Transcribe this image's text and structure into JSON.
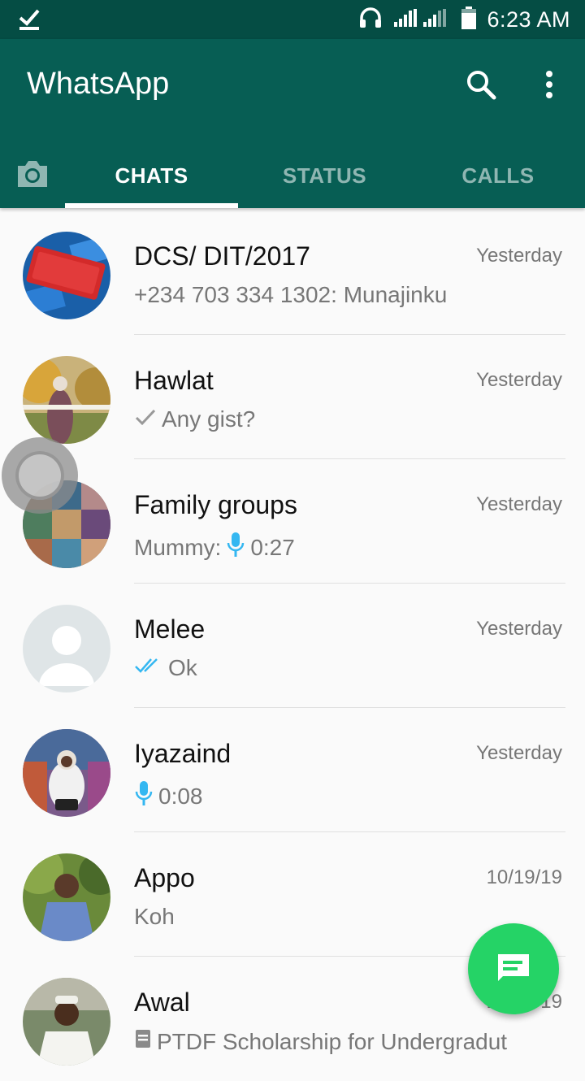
{
  "status_bar": {
    "time": "6:23 AM"
  },
  "app_bar": {
    "title": "WhatsApp"
  },
  "tabs": [
    {
      "label": "CHATS",
      "active": true
    },
    {
      "label": "STATUS",
      "active": false
    },
    {
      "label": "CALLS",
      "active": false
    }
  ],
  "chats": [
    {
      "name": "DCS/ DIT/2017",
      "time": "Yesterday",
      "message": "+234 703 334 1302: Munajinku"
    },
    {
      "name": "Hawlat",
      "time": "Yesterday",
      "message": "Any gist?"
    },
    {
      "name": "Family groups",
      "time": "Yesterday",
      "message_prefix": "Mummy:",
      "message": "0:27"
    },
    {
      "name": "Melee",
      "time": "Yesterday",
      "message": "Ok"
    },
    {
      "name": "Iyazaind",
      "time": "Yesterday",
      "message": "0:08"
    },
    {
      "name": "Appo",
      "time": "10/19/19",
      "message": "Koh"
    },
    {
      "name": "Awal",
      "time": "10/19/19",
      "message": "PTDF Scholarship for Undergradut"
    }
  ],
  "colors": {
    "header": "#075e54",
    "status_bar": "#054d44",
    "fab": "#25d366",
    "read_tick": "#34b7f1"
  }
}
